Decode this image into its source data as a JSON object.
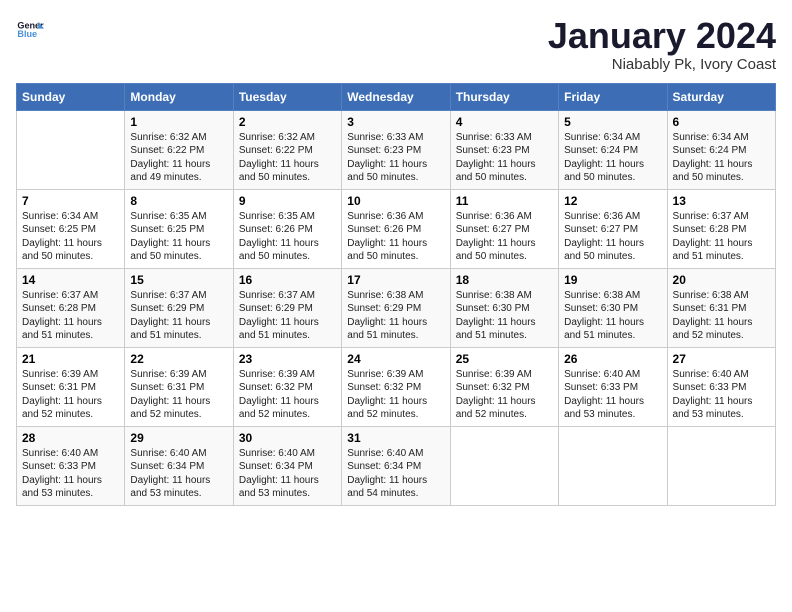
{
  "logo": {
    "text_general": "General",
    "text_blue": "Blue"
  },
  "title": "January 2024",
  "subtitle": "Niabably Pk, Ivory Coast",
  "days_header": [
    "Sunday",
    "Monday",
    "Tuesday",
    "Wednesday",
    "Thursday",
    "Friday",
    "Saturday"
  ],
  "weeks": [
    [
      {
        "num": "",
        "lines": []
      },
      {
        "num": "1",
        "lines": [
          "Sunrise: 6:32 AM",
          "Sunset: 6:22 PM",
          "Daylight: 11 hours",
          "and 49 minutes."
        ]
      },
      {
        "num": "2",
        "lines": [
          "Sunrise: 6:32 AM",
          "Sunset: 6:22 PM",
          "Daylight: 11 hours",
          "and 50 minutes."
        ]
      },
      {
        "num": "3",
        "lines": [
          "Sunrise: 6:33 AM",
          "Sunset: 6:23 PM",
          "Daylight: 11 hours",
          "and 50 minutes."
        ]
      },
      {
        "num": "4",
        "lines": [
          "Sunrise: 6:33 AM",
          "Sunset: 6:23 PM",
          "Daylight: 11 hours",
          "and 50 minutes."
        ]
      },
      {
        "num": "5",
        "lines": [
          "Sunrise: 6:34 AM",
          "Sunset: 6:24 PM",
          "Daylight: 11 hours",
          "and 50 minutes."
        ]
      },
      {
        "num": "6",
        "lines": [
          "Sunrise: 6:34 AM",
          "Sunset: 6:24 PM",
          "Daylight: 11 hours",
          "and 50 minutes."
        ]
      }
    ],
    [
      {
        "num": "7",
        "lines": [
          "Sunrise: 6:34 AM",
          "Sunset: 6:25 PM",
          "Daylight: 11 hours",
          "and 50 minutes."
        ]
      },
      {
        "num": "8",
        "lines": [
          "Sunrise: 6:35 AM",
          "Sunset: 6:25 PM",
          "Daylight: 11 hours",
          "and 50 minutes."
        ]
      },
      {
        "num": "9",
        "lines": [
          "Sunrise: 6:35 AM",
          "Sunset: 6:26 PM",
          "Daylight: 11 hours",
          "and 50 minutes."
        ]
      },
      {
        "num": "10",
        "lines": [
          "Sunrise: 6:36 AM",
          "Sunset: 6:26 PM",
          "Daylight: 11 hours",
          "and 50 minutes."
        ]
      },
      {
        "num": "11",
        "lines": [
          "Sunrise: 6:36 AM",
          "Sunset: 6:27 PM",
          "Daylight: 11 hours",
          "and 50 minutes."
        ]
      },
      {
        "num": "12",
        "lines": [
          "Sunrise: 6:36 AM",
          "Sunset: 6:27 PM",
          "Daylight: 11 hours",
          "and 50 minutes."
        ]
      },
      {
        "num": "13",
        "lines": [
          "Sunrise: 6:37 AM",
          "Sunset: 6:28 PM",
          "Daylight: 11 hours",
          "and 51 minutes."
        ]
      }
    ],
    [
      {
        "num": "14",
        "lines": [
          "Sunrise: 6:37 AM",
          "Sunset: 6:28 PM",
          "Daylight: 11 hours",
          "and 51 minutes."
        ]
      },
      {
        "num": "15",
        "lines": [
          "Sunrise: 6:37 AM",
          "Sunset: 6:29 PM",
          "Daylight: 11 hours",
          "and 51 minutes."
        ]
      },
      {
        "num": "16",
        "lines": [
          "Sunrise: 6:37 AM",
          "Sunset: 6:29 PM",
          "Daylight: 11 hours",
          "and 51 minutes."
        ]
      },
      {
        "num": "17",
        "lines": [
          "Sunrise: 6:38 AM",
          "Sunset: 6:29 PM",
          "Daylight: 11 hours",
          "and 51 minutes."
        ]
      },
      {
        "num": "18",
        "lines": [
          "Sunrise: 6:38 AM",
          "Sunset: 6:30 PM",
          "Daylight: 11 hours",
          "and 51 minutes."
        ]
      },
      {
        "num": "19",
        "lines": [
          "Sunrise: 6:38 AM",
          "Sunset: 6:30 PM",
          "Daylight: 11 hours",
          "and 51 minutes."
        ]
      },
      {
        "num": "20",
        "lines": [
          "Sunrise: 6:38 AM",
          "Sunset: 6:31 PM",
          "Daylight: 11 hours",
          "and 52 minutes."
        ]
      }
    ],
    [
      {
        "num": "21",
        "lines": [
          "Sunrise: 6:39 AM",
          "Sunset: 6:31 PM",
          "Daylight: 11 hours",
          "and 52 minutes."
        ]
      },
      {
        "num": "22",
        "lines": [
          "Sunrise: 6:39 AM",
          "Sunset: 6:31 PM",
          "Daylight: 11 hours",
          "and 52 minutes."
        ]
      },
      {
        "num": "23",
        "lines": [
          "Sunrise: 6:39 AM",
          "Sunset: 6:32 PM",
          "Daylight: 11 hours",
          "and 52 minutes."
        ]
      },
      {
        "num": "24",
        "lines": [
          "Sunrise: 6:39 AM",
          "Sunset: 6:32 PM",
          "Daylight: 11 hours",
          "and 52 minutes."
        ]
      },
      {
        "num": "25",
        "lines": [
          "Sunrise: 6:39 AM",
          "Sunset: 6:32 PM",
          "Daylight: 11 hours",
          "and 52 minutes."
        ]
      },
      {
        "num": "26",
        "lines": [
          "Sunrise: 6:40 AM",
          "Sunset: 6:33 PM",
          "Daylight: 11 hours",
          "and 53 minutes."
        ]
      },
      {
        "num": "27",
        "lines": [
          "Sunrise: 6:40 AM",
          "Sunset: 6:33 PM",
          "Daylight: 11 hours",
          "and 53 minutes."
        ]
      }
    ],
    [
      {
        "num": "28",
        "lines": [
          "Sunrise: 6:40 AM",
          "Sunset: 6:33 PM",
          "Daylight: 11 hours",
          "and 53 minutes."
        ]
      },
      {
        "num": "29",
        "lines": [
          "Sunrise: 6:40 AM",
          "Sunset: 6:34 PM",
          "Daylight: 11 hours",
          "and 53 minutes."
        ]
      },
      {
        "num": "30",
        "lines": [
          "Sunrise: 6:40 AM",
          "Sunset: 6:34 PM",
          "Daylight: 11 hours",
          "and 53 minutes."
        ]
      },
      {
        "num": "31",
        "lines": [
          "Sunrise: 6:40 AM",
          "Sunset: 6:34 PM",
          "Daylight: 11 hours",
          "and 54 minutes."
        ]
      },
      {
        "num": "",
        "lines": []
      },
      {
        "num": "",
        "lines": []
      },
      {
        "num": "",
        "lines": []
      }
    ]
  ]
}
